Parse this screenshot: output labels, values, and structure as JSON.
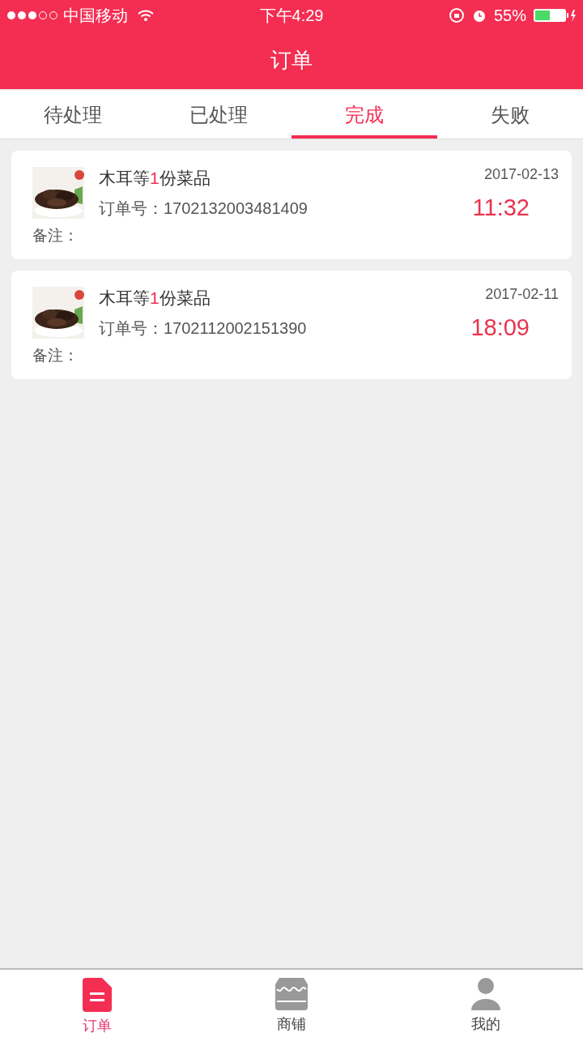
{
  "status_bar": {
    "carrier": "中国移动",
    "time": "下午4:29",
    "battery": "55%"
  },
  "header": {
    "title": "订单"
  },
  "tabs": [
    {
      "label": "待处理",
      "selected": false
    },
    {
      "label": "已处理",
      "selected": false
    },
    {
      "label": "完成",
      "selected": true
    },
    {
      "label": "失败",
      "selected": false
    }
  ],
  "orders": [
    {
      "kind": "picture",
      "title_prefix": "木耳等",
      "count": "1",
      "title_suffix": "份菜品",
      "order_label": "订单号：",
      "order_no": "1702132003481409",
      "date": "2017-02-13",
      "time": "11:32",
      "note_label": "备注："
    },
    {
      "kind": "picture",
      "title_prefix": "木耳等",
      "count": "1",
      "title_suffix": "份菜品",
      "order_label": "订单号：",
      "order_no": "1702112002151390",
      "date": "2017-02-11",
      "time": "18:09",
      "note_label": "备注："
    }
  ],
  "tab_bar": [
    {
      "kind": "orders",
      "label": "订单",
      "selected": true
    },
    {
      "kind": "shop",
      "label": "商铺",
      "selected": false
    },
    {
      "kind": "me",
      "label": "我的",
      "selected": false
    }
  ]
}
